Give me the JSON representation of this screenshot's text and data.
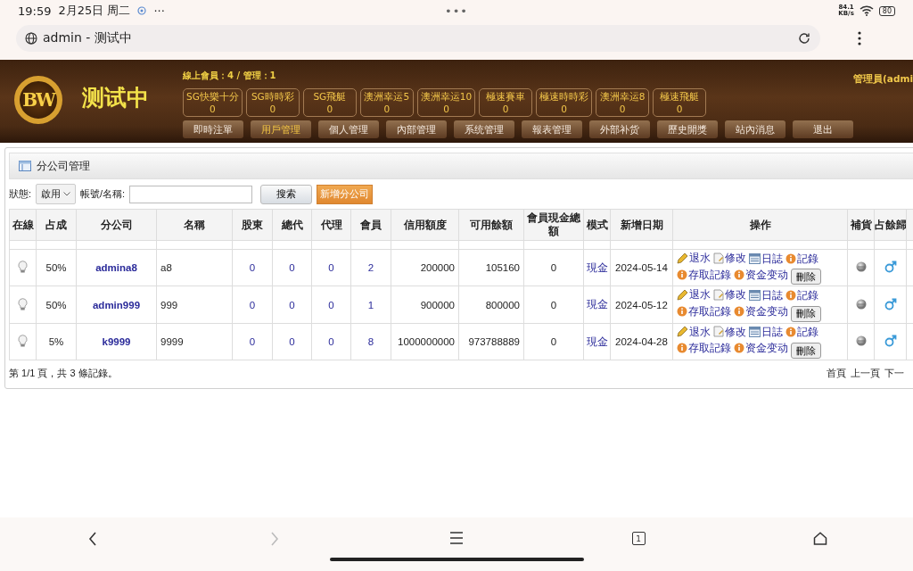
{
  "status_bar": {
    "time": "19:59",
    "date": "2月25日 周二",
    "more": "···",
    "center": "•••",
    "speed_value": "84.1",
    "speed_unit": "KB/s",
    "battery": "80"
  },
  "browser": {
    "title": "admin - 测试中"
  },
  "header": {
    "logo": "BW",
    "site_title": "测试中",
    "online_info": "線上會員：4 / 管理：1",
    "user": "管理員(admi",
    "lotteries": [
      {
        "name": "SG快樂十分",
        "count": "0"
      },
      {
        "name": "SG時時彩",
        "count": "0"
      },
      {
        "name": "SG飛艇",
        "count": "0"
      },
      {
        "name": "澳洲幸运5",
        "count": "0"
      },
      {
        "name": "澳洲幸运10",
        "count": "0"
      },
      {
        "name": "極速賽車",
        "count": "0"
      },
      {
        "name": "極速時時彩",
        "count": "0"
      },
      {
        "name": "澳洲幸运8",
        "count": "0"
      },
      {
        "name": "極速飛艇",
        "count": "0"
      }
    ],
    "nav": [
      {
        "label": "即時注單",
        "selected": false
      },
      {
        "label": "用戶管理",
        "selected": true
      },
      {
        "label": "個人管理",
        "selected": false
      },
      {
        "label": "內部管理",
        "selected": false
      },
      {
        "label": "系统管理",
        "selected": false
      },
      {
        "label": "報表管理",
        "selected": false
      },
      {
        "label": "外部补货",
        "selected": false
      },
      {
        "label": "歷史開獎",
        "selected": false
      },
      {
        "label": "站內消息",
        "selected": false
      },
      {
        "label": "退出",
        "selected": false
      }
    ]
  },
  "panel": {
    "title": "分公司管理",
    "filters": {
      "status_label": "狀態:",
      "status_value": "啟用",
      "name_label": "帳號/名稱:",
      "search_button": "搜索",
      "add_button": "新增分公司"
    },
    "table": {
      "columns": [
        "在線",
        "占成",
        "分公司",
        "名稱",
        "股東",
        "總代",
        "代理",
        "會員",
        "信用額度",
        "可用餘額",
        "會員現金總額",
        "模式",
        "新增日期",
        "操作",
        "補貨",
        "占餘歸"
      ],
      "rows": [
        {
          "online": false,
          "share": "50%",
          "company": "admina8",
          "name": "a8",
          "shareholders": "0",
          "general_agents": "0",
          "agents": "0",
          "members": "2",
          "credit": "200000",
          "available": "105160",
          "member_cash": "0",
          "mode": "現金",
          "created": "2024-05-14",
          "actions": [
            {
              "kind": "pencil",
              "label": "退水"
            },
            {
              "kind": "page",
              "label": "修改"
            },
            {
              "kind": "log",
              "label": "日誌"
            },
            {
              "kind": "info",
              "label": "記錄"
            },
            {
              "kind": "info",
              "label": "存取記錄"
            },
            {
              "kind": "info",
              "label": "资金变动"
            }
          ],
          "delete": "刪除"
        },
        {
          "online": false,
          "share": "50%",
          "company": "admin999",
          "name": "999",
          "shareholders": "0",
          "general_agents": "0",
          "agents": "0",
          "members": "1",
          "credit": "900000",
          "available": "800000",
          "member_cash": "0",
          "mode": "現金",
          "created": "2024-05-12",
          "actions": [
            {
              "kind": "pencil",
              "label": "退水"
            },
            {
              "kind": "page",
              "label": "修改"
            },
            {
              "kind": "log",
              "label": "日誌"
            },
            {
              "kind": "info",
              "label": "記錄"
            },
            {
              "kind": "info",
              "label": "存取記錄"
            },
            {
              "kind": "info",
              "label": "资金变动"
            }
          ],
          "delete": "刪除"
        },
        {
          "online": false,
          "share": "5%",
          "company": "k9999",
          "name": "9999",
          "shareholders": "0",
          "general_agents": "0",
          "agents": "0",
          "members": "8",
          "credit": "1000000000",
          "available": "973788889",
          "member_cash": "0",
          "mode": "現金",
          "created": "2024-04-28",
          "actions": [
            {
              "kind": "pencil",
              "label": "退水"
            },
            {
              "kind": "page",
              "label": "修改"
            },
            {
              "kind": "log",
              "label": "日誌"
            },
            {
              "kind": "info",
              "label": "記錄"
            },
            {
              "kind": "info",
              "label": "存取記錄"
            },
            {
              "kind": "info",
              "label": "资金变动"
            }
          ],
          "delete": "刪除"
        }
      ]
    },
    "footer": {
      "summary": "第 1/1 頁，共 3 條記錄。",
      "pager": [
        "首頁",
        "上一頁",
        "下一"
      ]
    }
  },
  "navigation": {
    "forward_disabled": true,
    "tab_count": "1"
  }
}
